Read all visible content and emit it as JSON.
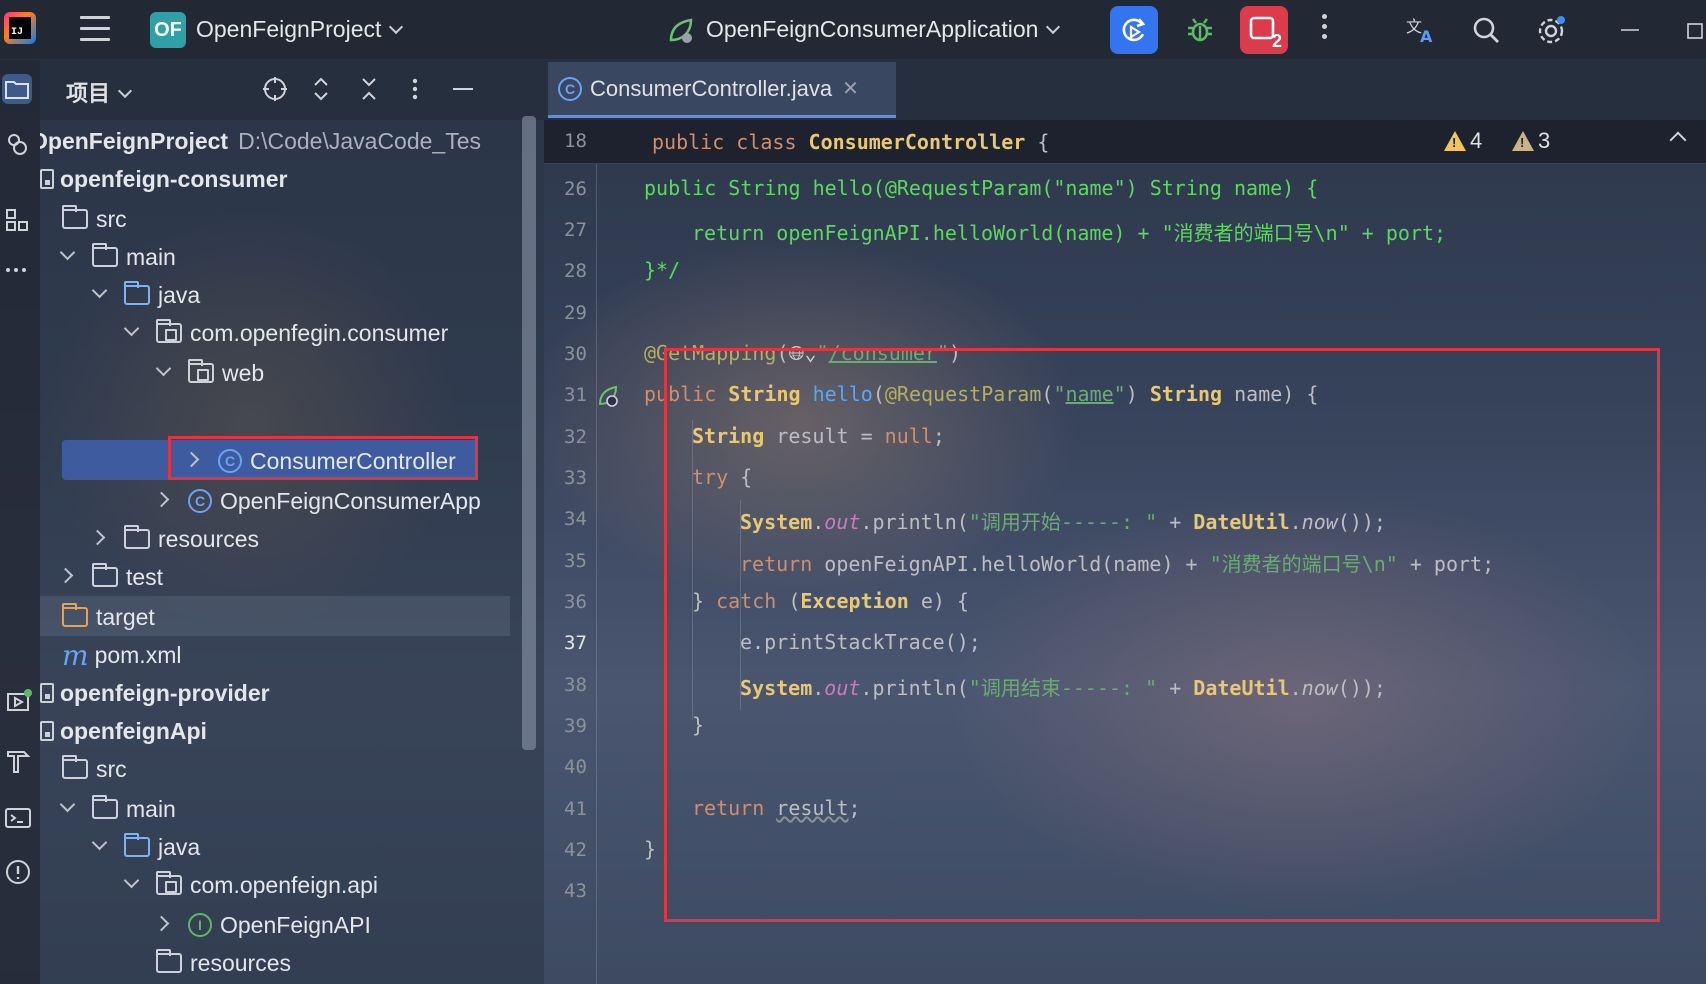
{
  "topbar": {
    "project_badge": "OF",
    "project_name": "OpenFeignProject",
    "run_config": "OpenFeignConsumerApplication",
    "stop_badge_count": "2"
  },
  "project_panel": {
    "title": "项目",
    "tree": [
      {
        "label": "OpenFeignProject",
        "extra": "D:\\Code\\JavaCode_Tes",
        "kind": "module",
        "level": 0
      },
      {
        "label": "openfeign-consumer",
        "kind": "module",
        "level": 0
      },
      {
        "label": "src",
        "kind": "folder",
        "level": 1
      },
      {
        "label": "main",
        "kind": "folder",
        "level": 2
      },
      {
        "label": "java",
        "kind": "folder-blue",
        "level": 3
      },
      {
        "label": "com.openfegin.consumer",
        "kind": "package",
        "level": 4
      },
      {
        "label": "web",
        "kind": "package",
        "level": 5
      },
      {
        "label": "ConsumerController",
        "kind": "class",
        "level": 6
      },
      {
        "label": "OpenFeignConsumerApp",
        "kind": "class",
        "level": 5
      },
      {
        "label": "resources",
        "kind": "folder",
        "level": 3
      },
      {
        "label": "test",
        "kind": "folder",
        "level": 2
      },
      {
        "label": "target",
        "kind": "folder-orange",
        "level": 1
      },
      {
        "label": "pom.xml",
        "kind": "maven",
        "level": 1
      },
      {
        "label": "openfeign-provider",
        "kind": "module",
        "level": 0
      },
      {
        "label": "openfeignApi",
        "kind": "module",
        "level": 0
      },
      {
        "label": "src",
        "kind": "folder",
        "level": 1
      },
      {
        "label": "main",
        "kind": "folder",
        "level": 2
      },
      {
        "label": "java",
        "kind": "folder-blue",
        "level": 3
      },
      {
        "label": "com.openfeign.api",
        "kind": "package",
        "level": 4
      },
      {
        "label": "OpenFeignAPI",
        "kind": "interface",
        "level": 5
      },
      {
        "label": "resources",
        "kind": "folder",
        "level": 3
      }
    ]
  },
  "editor": {
    "tab_label": "ConsumerController.java",
    "warnings_count": "4",
    "weak_warnings_count": "3",
    "sticky_line_number": "18",
    "line_numbers": [
      "26",
      "27",
      "28",
      "29",
      "30",
      "31",
      "32",
      "33",
      "34",
      "35",
      "36",
      "37",
      "38",
      "39",
      "40",
      "41",
      "42",
      "43"
    ],
    "current_line": "37"
  }
}
